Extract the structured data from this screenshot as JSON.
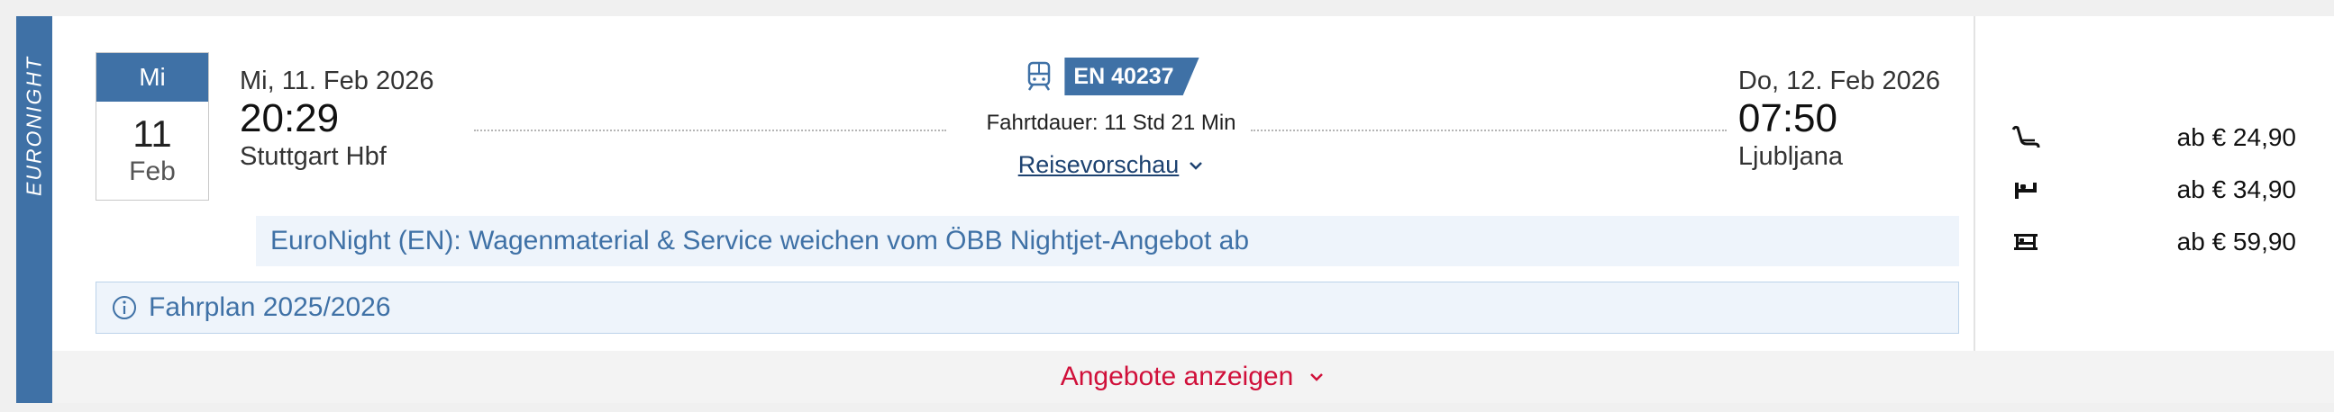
{
  "category_label": "EURONIGHT",
  "date_box": {
    "weekday": "Mi",
    "day": "11",
    "month": "Feb"
  },
  "departure": {
    "date": "Mi, 11. Feb 2026",
    "time": "20:29",
    "station": "Stuttgart Hbf"
  },
  "arrival": {
    "date": "Do, 12. Feb 2026",
    "time": "07:50",
    "station": "Ljubljana"
  },
  "train": {
    "number": "EN 40237",
    "icon": "train-icon",
    "duration": "Fahrtdauer: 11 Std 21 Min",
    "preview_label": "Reisevorschau"
  },
  "notice": "EuroNight (EN): Wagenmaterial & Service weichen vom ÖBB Nightjet-Angebot ab",
  "timetable_info": "Fahrplan 2025/2026",
  "prices": [
    {
      "icon": "seat-icon",
      "label": "ab € 24,90"
    },
    {
      "icon": "couchette-icon",
      "label": "ab € 34,90"
    },
    {
      "icon": "bed-icon",
      "label": "ab € 59,90"
    }
  ],
  "footer": {
    "label": "Angebote anzeigen"
  },
  "colors": {
    "brand_blue": "#3f71a6",
    "link_blue": "#1d4270",
    "accent_red": "#d0103a",
    "notice_bg": "#eef4fb"
  }
}
